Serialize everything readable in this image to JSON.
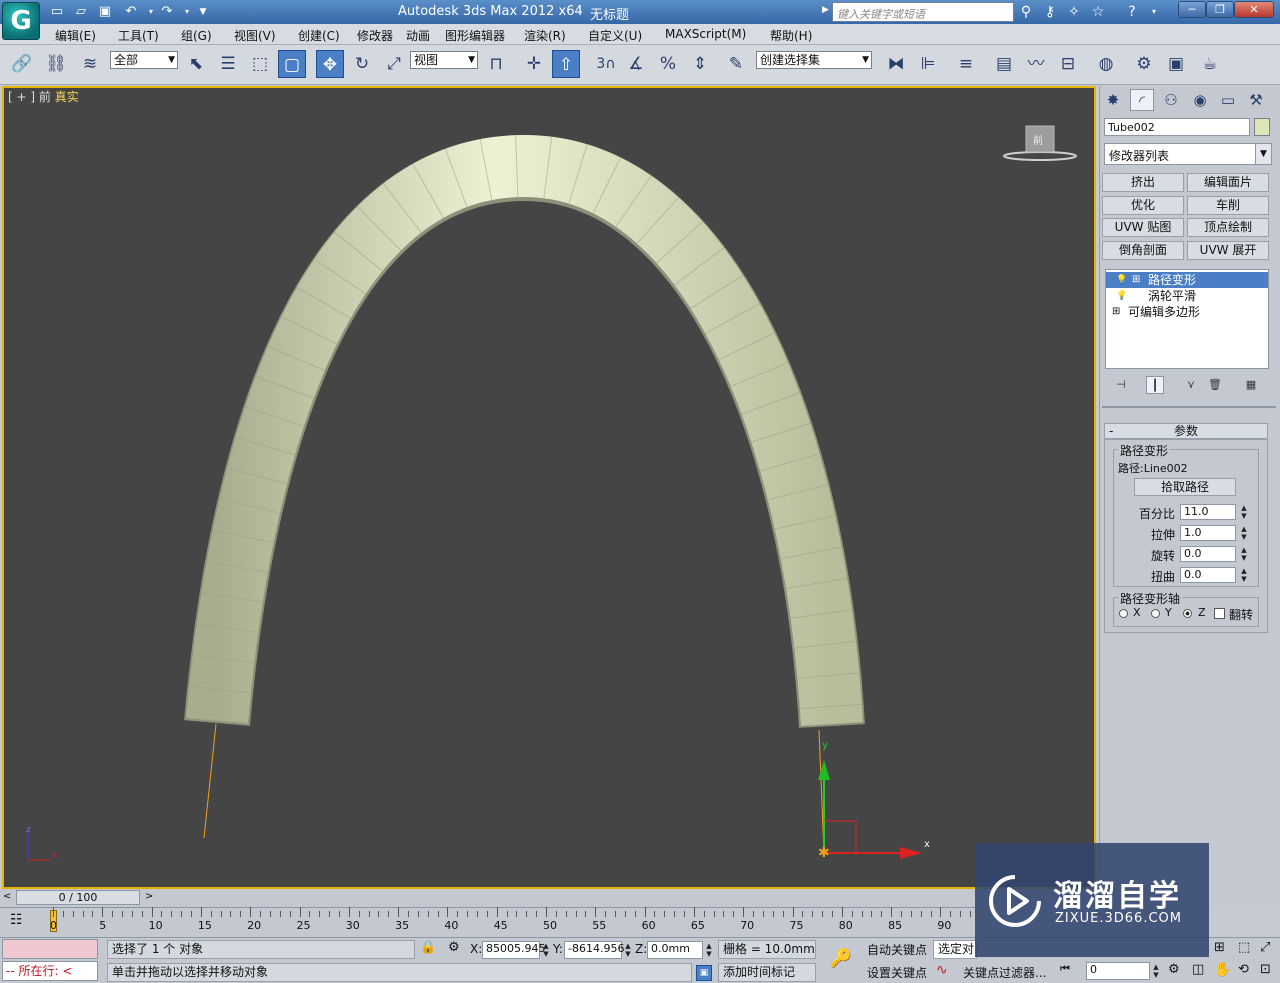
{
  "titlebar": {
    "logo": "G",
    "app_title": "Autodesk 3ds Max  2012 x64",
    "document": "无标题",
    "search_placeholder": "键入关键字或短语"
  },
  "menus": [
    "编辑(E)",
    "工具(T)",
    "组(G)",
    "视图(V)",
    "创建(C)",
    "修改器",
    "动画",
    "图形编辑器",
    "渲染(R)",
    "自定义(U)",
    "MAXScript(M)",
    "帮助(H)"
  ],
  "toolbar": {
    "selection_filter": "全部",
    "ref_coord": "视图",
    "named_selection": "创建选择集",
    "snap_3": "3"
  },
  "viewport": {
    "label_bracket1": "[ + ]",
    "label_view": "前",
    "label_mode": "真实",
    "viewcube_label": "前",
    "axis_x": "x",
    "axis_y": "y",
    "axis_z": "z"
  },
  "panel": {
    "object_name": "Tube002",
    "modifier_list": "修改器列表",
    "mod_buttons": [
      "挤出",
      "编辑面片",
      "优化",
      "车削",
      "UVW 贴图",
      "顶点绘制",
      "倒角剖面",
      "UVW 展开"
    ],
    "stack": [
      "路径变形",
      "涡轮平滑",
      "可编辑多边形"
    ],
    "rollout_title": "参数",
    "rollout_minus": "-",
    "group_path": "路径变形",
    "path_label": "路径:",
    "path_value": "Line002",
    "pick_path": "拾取路径",
    "percent_label": "百分比",
    "percent_value": "11.0",
    "stretch_label": "拉伸",
    "stretch_value": "1.0",
    "rotate_label": "旋转",
    "rotate_value": "0.0",
    "twist_label": "扭曲",
    "twist_value": "0.0",
    "group_axis": "路径变形轴",
    "axis_x": "X",
    "axis_y": "Y",
    "axis_z": "Z",
    "axis_selected": "Z",
    "flip_label": "翻转"
  },
  "timeline": {
    "frame_display": "0 / 100",
    "ticks": [
      "0",
      "5",
      "10",
      "15",
      "20",
      "25",
      "30",
      "35",
      "40",
      "45",
      "50",
      "55",
      "60",
      "65",
      "70",
      "75",
      "80",
      "85",
      "90"
    ]
  },
  "status": {
    "location_label": "所在行:",
    "selection_msg": "选择了 1 个 对象",
    "prompt_msg": "单击并拖动以选择并移动对象",
    "x_label": "X:",
    "x_value": "85005.945",
    "y_label": "Y:",
    "y_value": "-8614.956",
    "z_label": "Z:",
    "z_value": "0.0mm",
    "grid": "栅格 = 10.0mm",
    "add_time_tag": "添加时间标记",
    "auto_key": "自动关键点",
    "set_key": "设置关键点",
    "selected_dropdown": "选定对",
    "key_filters": "关键点过滤器...",
    "frame_field": "0"
  },
  "watermark": {
    "brand": "溜溜自学",
    "url": "ZIXUE.3D66.COM"
  }
}
